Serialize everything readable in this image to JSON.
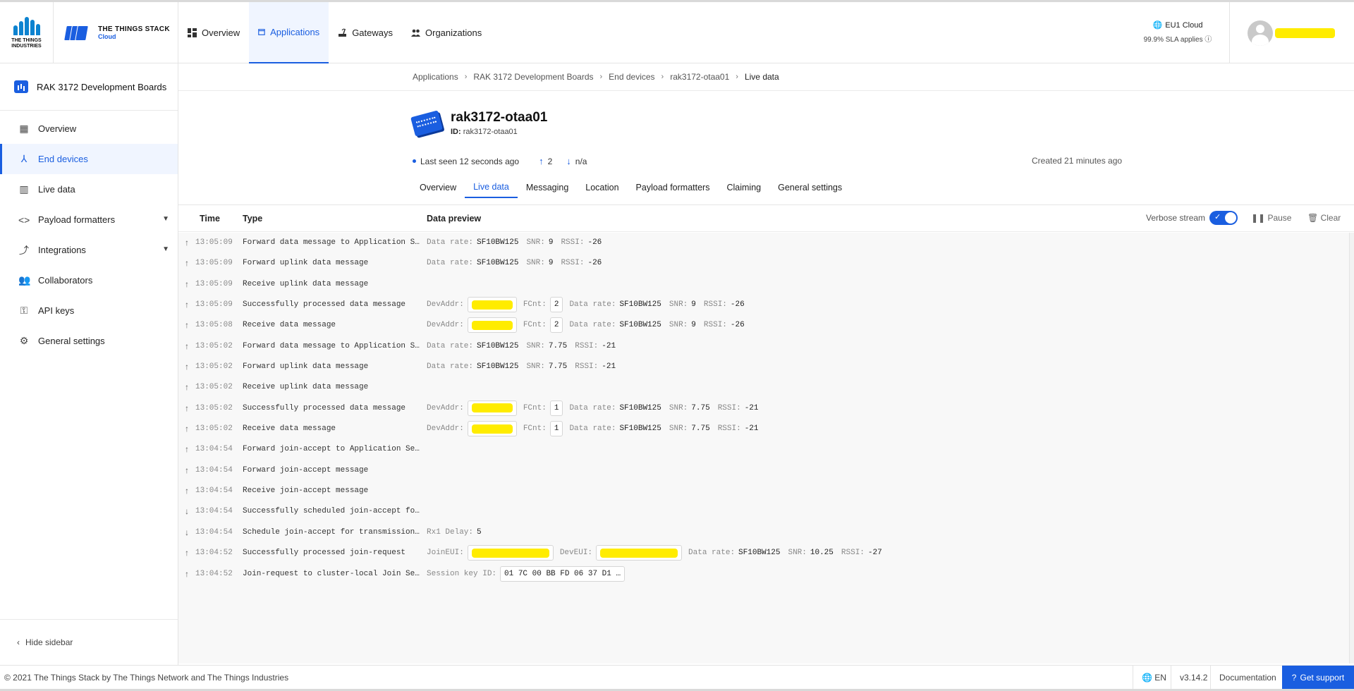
{
  "brand": {
    "tti_name": "THE THINGS INDUSTRIES",
    "stack_name": "THE THINGS STACK",
    "stack_sub": "Cloud"
  },
  "topnav": [
    {
      "label": "Overview",
      "icon": "grid-icon"
    },
    {
      "label": "Applications",
      "icon": "window-icon"
    },
    {
      "label": "Gateways",
      "icon": "gateway-icon"
    },
    {
      "label": "Organizations",
      "icon": "people-icon"
    }
  ],
  "cloud": {
    "region": "EU1 Cloud",
    "sla": "99.9% SLA applies"
  },
  "sidebar": {
    "app_name": "RAK 3172 Development Boards",
    "items": [
      {
        "label": "Overview",
        "icon": "grid-icon"
      },
      {
        "label": "End devices",
        "icon": "device-fork-icon"
      },
      {
        "label": "Live data",
        "icon": "bar-chart-icon"
      },
      {
        "label": "Payload formatters",
        "icon": "code-icon"
      },
      {
        "label": "Integrations",
        "icon": "merge-icon"
      },
      {
        "label": "Collaborators",
        "icon": "people-icon"
      },
      {
        "label": "API keys",
        "icon": "key-icon"
      },
      {
        "label": "General settings",
        "icon": "gear-icon"
      }
    ],
    "hide_label": "Hide sidebar"
  },
  "breadcrumbs": [
    "Applications",
    "RAK 3172 Development Boards",
    "End devices",
    "rak3172-otaa01",
    "Live data"
  ],
  "device": {
    "name": "rak3172-otaa01",
    "id_label": "ID:",
    "id_value": "rak3172-otaa01",
    "last_seen": "Last seen 12 seconds ago",
    "uplink_count": "2",
    "downlink_count": "n/a",
    "created": "Created 21 minutes ago"
  },
  "device_tabs": [
    "Overview",
    "Live data",
    "Messaging",
    "Location",
    "Payload formatters",
    "Claiming",
    "General settings"
  ],
  "live": {
    "col_time": "Time",
    "col_type": "Type",
    "col_preview": "Data preview",
    "verbose_label": "Verbose stream",
    "pause_label": "Pause",
    "clear_label": "Clear",
    "rows": [
      {
        "dir": "up",
        "time": "13:05:09",
        "type": "Forward data message to Application S…",
        "preview": [
          [
            "Data rate:",
            "SF10BW125"
          ],
          [
            "SNR:",
            "9"
          ],
          [
            "RSSI:",
            "-26"
          ]
        ]
      },
      {
        "dir": "up",
        "time": "13:05:09",
        "type": "Forward uplink data message",
        "preview": [
          [
            "Data rate:",
            "SF10BW125"
          ],
          [
            "SNR:",
            "9"
          ],
          [
            "RSSI:",
            "-26"
          ]
        ]
      },
      {
        "dir": "up",
        "time": "13:05:09",
        "type": "Receive uplink data message",
        "preview": []
      },
      {
        "dir": "up",
        "time": "13:05:09",
        "type": "Successfully processed data message",
        "devaddr": true,
        "fcnt": "2",
        "preview": [
          [
            "Data rate:",
            "SF10BW125"
          ],
          [
            "SNR:",
            "9"
          ],
          [
            "RSSI:",
            "-26"
          ]
        ]
      },
      {
        "dir": "up",
        "time": "13:05:08",
        "type": "Receive data message",
        "devaddr": true,
        "fcnt": "2",
        "preview": [
          [
            "Data rate:",
            "SF10BW125"
          ],
          [
            "SNR:",
            "9"
          ],
          [
            "RSSI:",
            "-26"
          ]
        ]
      },
      {
        "dir": "up",
        "time": "13:05:02",
        "type": "Forward data message to Application S…",
        "preview": [
          [
            "Data rate:",
            "SF10BW125"
          ],
          [
            "SNR:",
            "7.75"
          ],
          [
            "RSSI:",
            "-21"
          ]
        ]
      },
      {
        "dir": "up",
        "time": "13:05:02",
        "type": "Forward uplink data message",
        "preview": [
          [
            "Data rate:",
            "SF10BW125"
          ],
          [
            "SNR:",
            "7.75"
          ],
          [
            "RSSI:",
            "-21"
          ]
        ]
      },
      {
        "dir": "up",
        "time": "13:05:02",
        "type": "Receive uplink data message",
        "preview": []
      },
      {
        "dir": "up",
        "time": "13:05:02",
        "type": "Successfully processed data message",
        "devaddr": true,
        "fcnt": "1",
        "preview": [
          [
            "Data rate:",
            "SF10BW125"
          ],
          [
            "SNR:",
            "7.75"
          ],
          [
            "RSSI:",
            "-21"
          ]
        ]
      },
      {
        "dir": "up",
        "time": "13:05:02",
        "type": "Receive data message",
        "devaddr": true,
        "fcnt": "1",
        "preview": [
          [
            "Data rate:",
            "SF10BW125"
          ],
          [
            "SNR:",
            "7.75"
          ],
          [
            "RSSI:",
            "-21"
          ]
        ]
      },
      {
        "dir": "up",
        "time": "13:04:54",
        "type": "Forward join-accept to Application Se…",
        "preview": []
      },
      {
        "dir": "up",
        "time": "13:04:54",
        "type": "Forward join-accept message",
        "preview": []
      },
      {
        "dir": "up",
        "time": "13:04:54",
        "type": "Receive join-accept message",
        "preview": []
      },
      {
        "dir": "down",
        "time": "13:04:54",
        "type": "Successfully scheduled join-accept fo…",
        "preview": []
      },
      {
        "dir": "down",
        "time": "13:04:54",
        "type": "Schedule join-accept for transmission…",
        "preview": [
          [
            "Rx1 Delay:",
            "5"
          ]
        ]
      },
      {
        "dir": "up",
        "time": "13:04:52",
        "type": "Successfully processed join-request",
        "joineui": true,
        "preview": [
          [
            "Data rate:",
            "SF10BW125"
          ],
          [
            "SNR:",
            "10.25"
          ],
          [
            "RSSI:",
            "-27"
          ]
        ]
      },
      {
        "dir": "up",
        "time": "13:04:52",
        "type": "Join-request to cluster-local Join Se…",
        "session_key": "01 7C 00 BB FD 06 37 D1 …",
        "preview": []
      }
    ],
    "labels": {
      "devaddr": "DevAddr:",
      "fcnt": "FCnt:",
      "joineui": "JoinEUI:",
      "deveui": "DevEUI:",
      "session_key": "Session key ID:"
    }
  },
  "footer": {
    "copyright": "© 2021 The Things Stack by The Things Network and The Things Industries",
    "language": "EN",
    "version": "v3.14.2",
    "docs": "Documentation",
    "support": "Get support"
  },
  "colors": {
    "accent": "#1a5ee0",
    "redaction": "#ffec00"
  }
}
